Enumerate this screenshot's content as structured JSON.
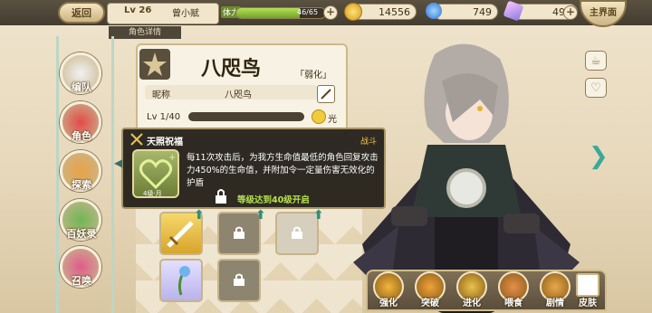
{
  "top_bar": {
    "back_label": "返回",
    "player_level": "Lv 26",
    "player_name": "曾小赋",
    "stamina_label": "体力",
    "stamina_value": "46/65",
    "stamina_fraction": 0.71,
    "gold": "14556",
    "gems": "749",
    "crystals": "499",
    "main_label": "主界面"
  },
  "tab_label": "角色详情",
  "left_nav": {
    "items": [
      {
        "label": "编队",
        "color": "#f2f2f2"
      },
      {
        "label": "角色",
        "color": "#e34a4a"
      },
      {
        "label": "探索",
        "color": "#e8a248"
      },
      {
        "label": "百妖录",
        "color": "#6fb654"
      },
      {
        "label": "召唤",
        "color": "#e05c8c"
      }
    ]
  },
  "character": {
    "name": "八咫鸟",
    "tag": "「弱化」",
    "nickname_label": "昵称",
    "nickname": "八咫鸟",
    "level": "Lv 1/40",
    "attribute": "光"
  },
  "tooltip": {
    "title": "天照祝福",
    "type": "战斗",
    "description": "每11次攻击后，为我方生命值最低的角色回复攻击力450%的生命值，并附加令一定量伤害无效化的护盾",
    "unlock": "等级达到40级开启",
    "skill_level": "4级·月"
  },
  "bottom_bar": {
    "buttons": [
      {
        "label": "强化",
        "color": "#f2b43c"
      },
      {
        "label": "突破",
        "color": "#f0a23a"
      },
      {
        "label": "进化",
        "color": "#e9c24a"
      },
      {
        "label": "喂食",
        "color": "#e58e4a"
      },
      {
        "label": "剧情",
        "color": "#e9a84a"
      }
    ],
    "last_label": "皮肤"
  },
  "colors": {
    "accent": "#6fa524",
    "panel": "#f8f2e4",
    "tooltip_bg": "#26221c"
  }
}
